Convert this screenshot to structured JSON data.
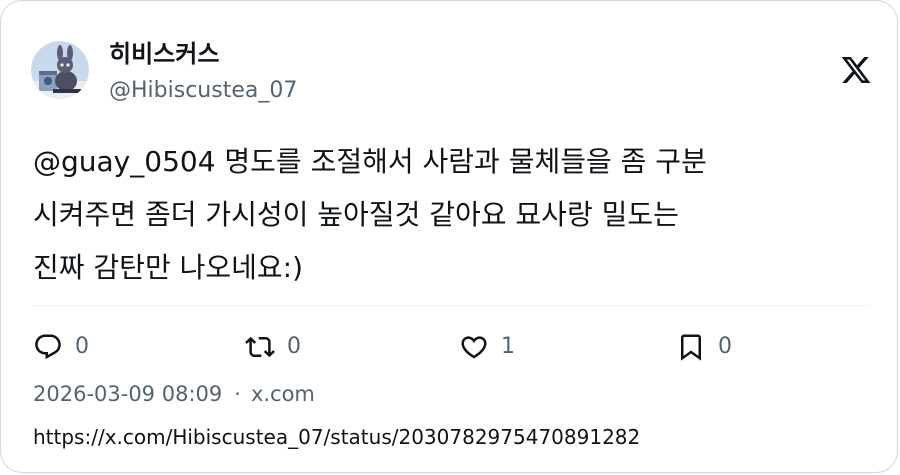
{
  "author": {
    "display_name": "히비스커스",
    "handle": "@Hibiscustea_07"
  },
  "tweet": {
    "text": "@guay_0504 명도를 조절해서 사람과 물체들을 좀 구분\n시켜주면 좀더 가시성이 높아질것 같아요 묘사랑 밀도는\n진짜 감탄만 나오네요:)"
  },
  "actions": {
    "reply": {
      "icon": "reply-icon",
      "count": "0"
    },
    "retweet": {
      "icon": "retweet-icon",
      "count": "0"
    },
    "like": {
      "icon": "heart-icon",
      "count": "1"
    },
    "bookmark": {
      "icon": "bookmark-icon",
      "count": "0"
    }
  },
  "meta": {
    "timestamp": "2026-03-09 08:09",
    "separator": "·",
    "source": "x.com"
  },
  "link": {
    "url": "https://x.com/Hibiscustea_07/status/2030782975470891282"
  },
  "colors": {
    "text": "#0f1419",
    "secondary": "#536471",
    "border": "#cfd9de",
    "divider": "#eff3f4"
  }
}
